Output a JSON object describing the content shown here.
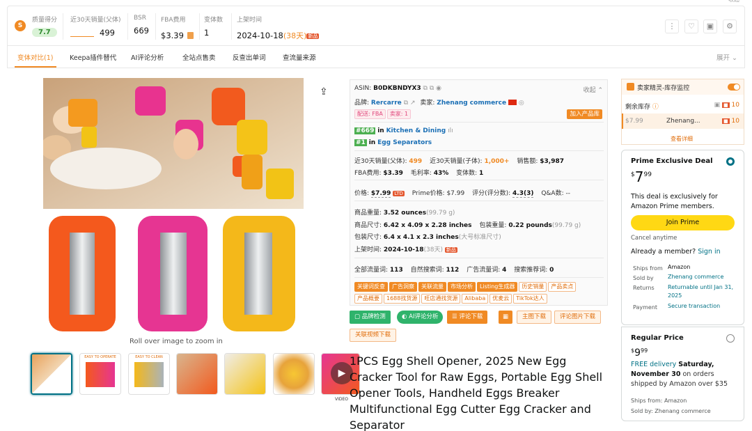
{
  "header": {
    "quality": {
      "label": "质量得分",
      "value": "7.7"
    },
    "sales30_parent": {
      "label": "近30天销量(父体)",
      "value": "499"
    },
    "bsr": {
      "label": "BSR",
      "value": "669"
    },
    "fba": {
      "label": "FBA费用",
      "value": "$3.39"
    },
    "variants": {
      "label": "变体数",
      "value": "1"
    },
    "launch": {
      "label": "上架时间",
      "value": "2024-10-18",
      "days": "(38天)",
      "badge": "新品"
    },
    "top_right_truncated": "收起"
  },
  "tabs": [
    "变体对比(1)",
    "Keepa插件替代",
    "AI评论分析",
    "全站点售卖",
    "反查出单词",
    "查流量来源"
  ],
  "expand_label": "展开",
  "gallery": {
    "zoom_hint": "Roll over image to zoom in",
    "video_label": "VIDEO",
    "thumbs": [
      "",
      "EASY TO OPERATE",
      "EASY TO CLEAN",
      "",
      "",
      "",
      ""
    ]
  },
  "panel": {
    "asin_label": "ASIN:",
    "asin": "B0DKBNDYX3",
    "collapse": "收起",
    "brand_label": "品牌:",
    "brand": "Rercarre",
    "seller_label": "卖家:",
    "seller": "Zhenang commerce",
    "ship_tags": [
      "配送: FBA",
      "卖家: 1"
    ],
    "add_library": "加入产品库",
    "rank1": "#669",
    "rank1_in": "in",
    "rank1_cat": "Kitchen & Dining",
    "rank2": "#1",
    "rank2_in": "in",
    "rank2_cat": "Egg Separators",
    "sales_parent_label": "近30天销量(父体):",
    "sales_parent": "499",
    "sales_child_label": "近30天销量(子体):",
    "sales_child": "1,000+",
    "revenue_label": "销售额:",
    "revenue": "$3,987",
    "fba_label": "FBA费用:",
    "fba": "$3.39",
    "margin_label": "毛利率:",
    "margin": "43%",
    "variant_label": "变体数:",
    "variant": "1",
    "price_label": "价格:",
    "price": "$7.99",
    "price_tag": "LTD",
    "prime_label": "Prime价格:",
    "prime": "$7.99",
    "rating_label": "评分(评分数):",
    "rating": "4.3(3)",
    "qa_label": "Q&A数:",
    "qa": "--",
    "weight_label": "商品重量:",
    "weight": "3.52 ounces",
    "weight_g": "(99.79 g)",
    "dim_label": "商品尺寸:",
    "dim": "6.42 x 4.09 x 2.28 inches",
    "pkg_weight_label": "包装重量:",
    "pkg_weight": "0.22 pounds",
    "pkg_weight_g": "(99.79 g)",
    "pkg_dim_label": "包装尺寸:",
    "pkg_dim": "6.4 x 4.1 x 2.3 inches",
    "pkg_dim_note": "(大号标准尺寸)",
    "launch_label": "上架时间:",
    "launch": "2024-10-18",
    "launch_days": "(38天)",
    "launch_badge": "新品",
    "traffic_label": "全部流量词:",
    "traffic": "113",
    "organic_label": "自然搜索词:",
    "organic": "112",
    "ad_label": "广告流量词:",
    "ad": "4",
    "rec_label": "搜索推荐词:",
    "rec": "0",
    "tools1": [
      "关键词反查",
      "广告洞察",
      "关联流量",
      "市场分析",
      "Listing生成器",
      "历史销量",
      "产品卖点"
    ],
    "tools2": [
      "产品概要",
      "1688找货源",
      "旺店通找货源",
      "Alibaba",
      "优麦云",
      "TikTok达人"
    ]
  },
  "actions": [
    "品牌检测",
    "AI评论分析",
    "评论下载",
    "",
    "主图下载",
    "评论图片下载",
    "关联视频下载"
  ],
  "title": "1PCS Egg Shell Opener, 2025 New Egg Cracker Tool for Raw Eggs, Portable Egg Shell Opener Tools, Handheld Eggs Breaker Multifunctional Egg Cutter Egg Cracker and Separator",
  "inventory": {
    "title": "卖家精灵-库存监控",
    "remaining_label": "剩余库存",
    "remaining": "10",
    "row_price": "$7.99",
    "row_seller": "Zhenang...",
    "row_qty": "10",
    "details": "查看详细"
  },
  "prime_deal": {
    "title": "Prime Exclusive Deal",
    "dollar": "$",
    "whole": "7",
    "cents": "99",
    "desc": "This deal is exclusively for Amazon Prime members.",
    "join": "Join Prime",
    "cancel": "Cancel anytime",
    "member_q": "Already a member?",
    "sign_in": "Sign in",
    "ships_from_label": "Ships from",
    "ships_from": "Amazon",
    "sold_by_label": "Sold by",
    "sold_by": "Zhenang commerce",
    "returns_label": "Returns",
    "returns": "Returnable until Jan 31, 2025",
    "payment_label": "Payment",
    "payment": "Secure transaction"
  },
  "regular": {
    "title": "Regular Price",
    "dollar": "$",
    "whole": "9",
    "cents": "99",
    "free": "FREE delivery",
    "date": "Saturday, November 30",
    "rest": "on orders shipped by Amazon over $35",
    "ships": "Ships from: Amazon",
    "sold": "Sold by: Zhenang commerce"
  }
}
